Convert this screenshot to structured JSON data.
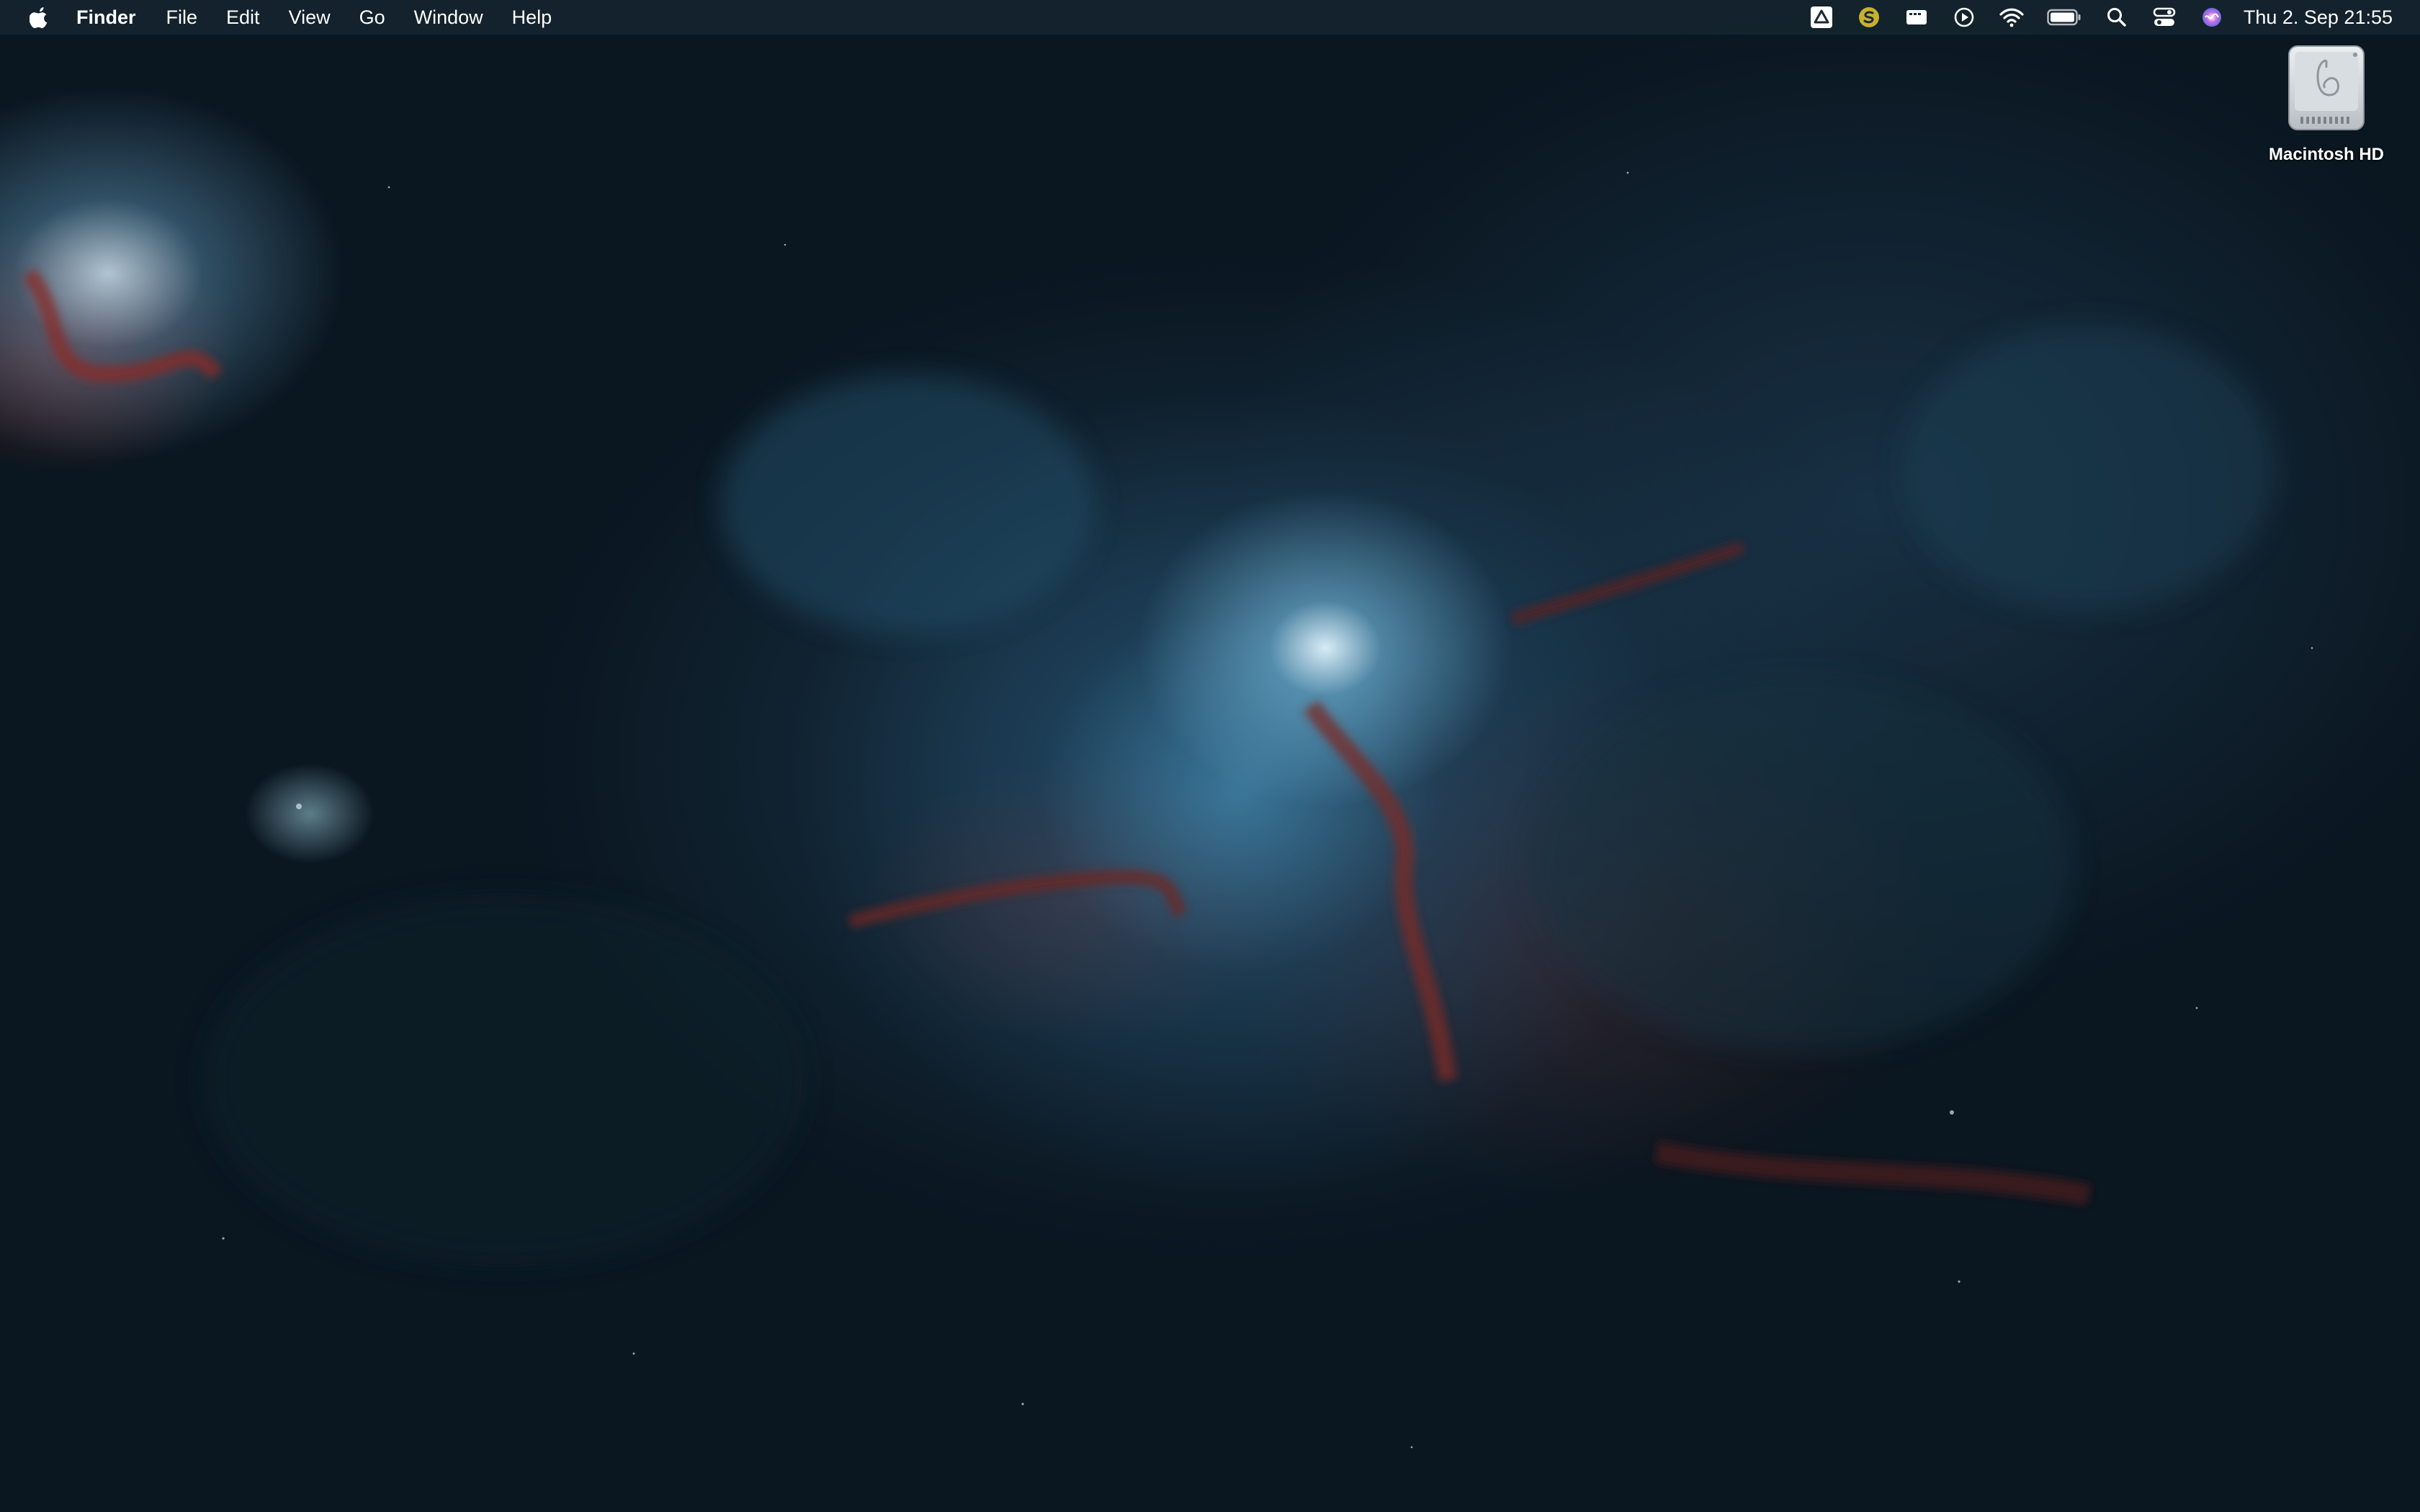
{
  "menubar": {
    "apple_icon": "apple-logo-icon",
    "app_name": "Finder",
    "menus": [
      "File",
      "Edit",
      "View",
      "Go",
      "Window",
      "Help"
    ],
    "status_icons": [
      "google-drive-icon",
      "sync-app-icon",
      "display-icon",
      "play-circle-icon",
      "wifi-icon",
      "battery-icon",
      "spotlight-search-icon",
      "control-center-icon",
      "siri-icon"
    ],
    "clock": "Thu 2. Sep  21:55"
  },
  "desktop": {
    "items": [
      {
        "label": "Macintosh HD",
        "icon": "hard-drive-icon"
      }
    ]
  },
  "colors": {
    "menubar_bg": "#162630",
    "wallpaper_base": "#0b161f",
    "nebula_blue": "#78bee1",
    "nebula_red": "#963230"
  }
}
